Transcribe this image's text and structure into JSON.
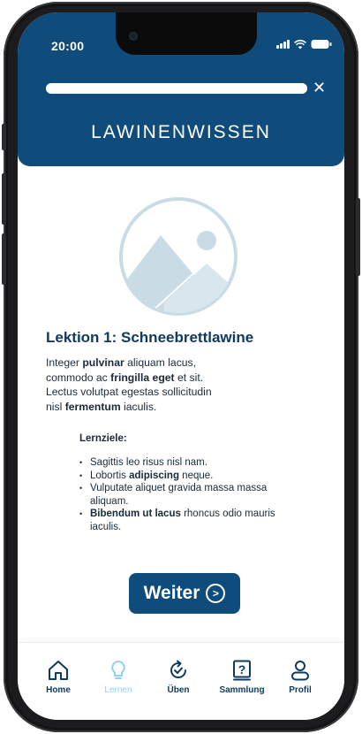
{
  "status_bar": {
    "time": "20:00"
  },
  "progress": {
    "value": 1.0
  },
  "header": {
    "title": "LAWINENWISSEN",
    "close_icon": "close-icon"
  },
  "lesson": {
    "title": "Lektion 1: Schneebrettlawine",
    "body": [
      [
        "Integer ",
        "pulvinar",
        " aliquam lacus,"
      ],
      [
        "commodo ac ",
        "fringilla eget",
        " et sit."
      ],
      [
        "Lectus volutpat egestas sollicitudin",
        "",
        ""
      ],
      [
        "nisl ",
        "fermentum",
        " iaculis."
      ]
    ],
    "goals_title": "Lernziele:",
    "goals": [
      {
        "pre": "Sagittis leo risus nisl nam.",
        "bold": "",
        "post": ""
      },
      {
        "pre": "Lobortis ",
        "bold": "adipiscing",
        "post": " neque."
      },
      {
        "pre": "Vulputate aliquet gravida massa massa aliquam.",
        "bold": "",
        "post": ""
      },
      {
        "pre": "",
        "bold": "Bibendum ut lacus",
        "post": " rhoncus odio mauris iaculis."
      }
    ]
  },
  "next_button": {
    "label": "Weiter",
    "icon": "chevron-right-circle-icon"
  },
  "tabs": [
    {
      "label": "Home",
      "icon": "home-icon",
      "active": false
    },
    {
      "label": "Lernen",
      "icon": "lightbulb-icon",
      "active": true
    },
    {
      "label": "Üben",
      "icon": "refresh-check-icon",
      "active": false
    },
    {
      "label": "Sammlung",
      "icon": "question-book-icon",
      "active": false
    },
    {
      "label": "Profil",
      "icon": "user-icon",
      "active": false
    }
  ],
  "colors": {
    "primary": "#0f4c7c",
    "heading": "#0f3a5f",
    "active_tab": "#8fd0f0",
    "illustration": "#c9dce6"
  }
}
